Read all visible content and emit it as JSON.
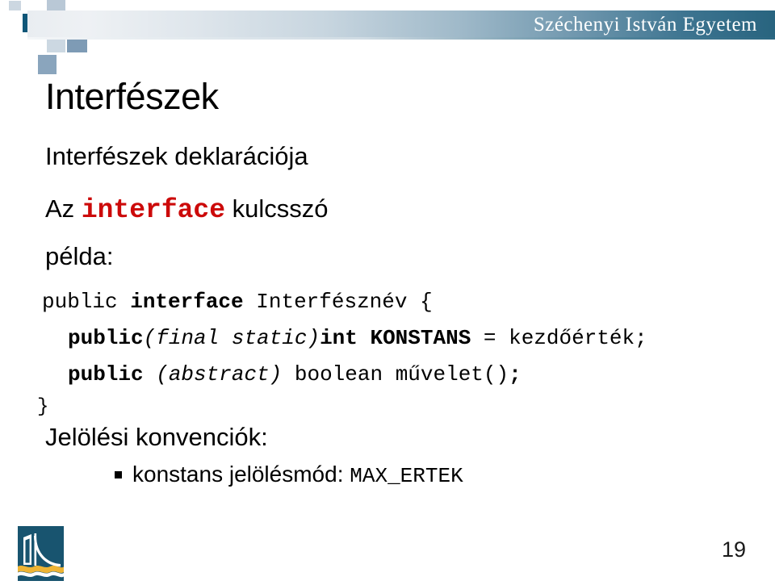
{
  "header": {
    "university": "Széchenyi István Egyetem",
    "logo_icon": "decorative-squares-logo",
    "band_accent_color": "#28647f"
  },
  "slide": {
    "title": "Interfészek",
    "subtitle": "Interfészek deklarációja",
    "keyword_line": {
      "prefix": "Az",
      "keyword": "interface",
      "keyword_color": "#cc0a0a",
      "suffix": "kulcsszó"
    },
    "example_label": "példa:",
    "code": {
      "line1": {
        "part1": "public ",
        "part2_bold": "interface",
        "part3": " Interfésznév {"
      },
      "line2": {
        "part1_bold": "public",
        "part2_italic": "(final static)",
        "part3_bold": "int KONSTANS",
        "part4": " = kezdőérték;"
      },
      "line3": {
        "part1_bold": "public",
        "part2_italic": " (abstract)",
        "part3": " boolean művelet()",
        "part4_bold": ";"
      },
      "line4": "}"
    },
    "conventions_label": "Jelölési konvenciók:",
    "bullets": [
      {
        "text": "konstans jelölésmód: ",
        "code": "MAX_ERTEK",
        "marker": "square-bullet"
      }
    ]
  },
  "footer": {
    "logo_icon": "szechenyi-bridge-logo",
    "page_number": "19"
  }
}
